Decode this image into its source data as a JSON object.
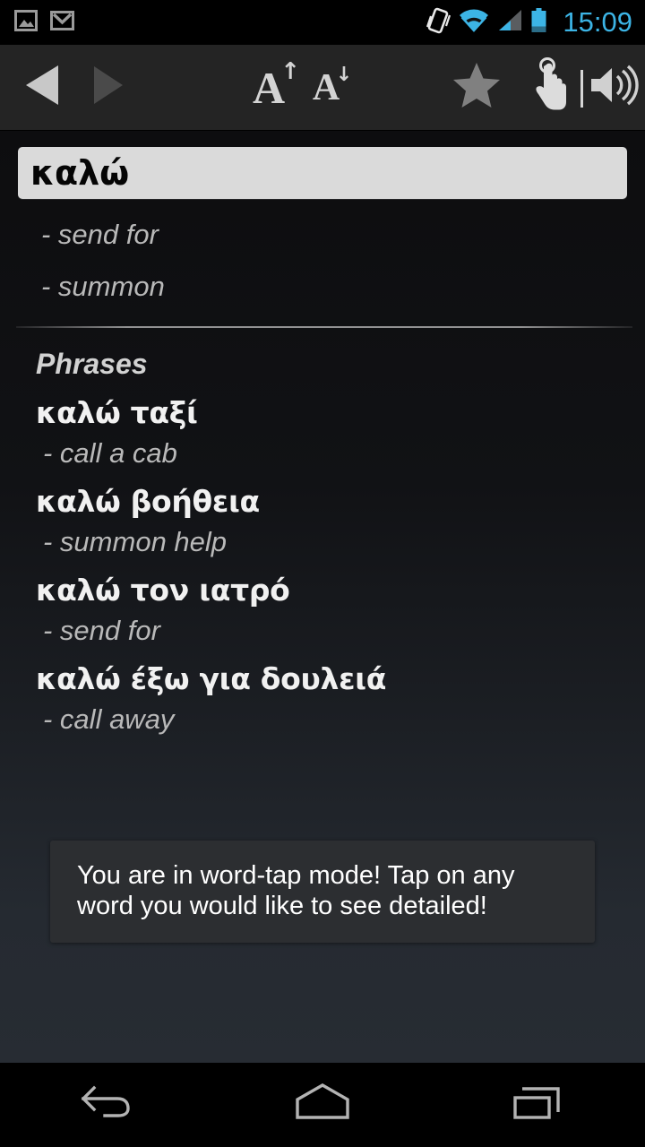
{
  "status_bar": {
    "notifications": [
      {
        "name": "gallery-icon",
        "label": "Gallery"
      },
      {
        "name": "gmail-icon",
        "label": "Gmail"
      }
    ],
    "indicators": [
      {
        "name": "vibrate-icon",
        "label": "Vibrate"
      },
      {
        "name": "wifi-icon",
        "label": "Wi-Fi"
      },
      {
        "name": "cellular-signal-icon",
        "label": "Signal"
      },
      {
        "name": "battery-icon",
        "label": "Battery"
      }
    ],
    "time": "15:09",
    "accent_color": "#3cb4e5"
  },
  "toolbar": {
    "nav_back_label": "Back",
    "nav_forward_label": "Forward",
    "font_increase_letter": "A",
    "font_increase_arrow": "↑",
    "font_decrease_letter": "A",
    "font_decrease_arrow": "↓",
    "favorite_label": "Favorite",
    "word_tap_label": "Word-tap mode",
    "sound_label": "Pronounce",
    "back_enabled": true,
    "forward_enabled": false,
    "enabled_color": "#c8c8c8",
    "disabled_color": "#4a4a4a",
    "background": "#242424"
  },
  "entry": {
    "headword": "καλώ",
    "definitions": [
      "- send for",
      "- summon"
    ]
  },
  "phrases_section": {
    "title": "Phrases",
    "items": [
      {
        "term": "καλώ ταξί",
        "definition": "- call a cab"
      },
      {
        "term": "καλώ βοήθεια",
        "definition": "- summon help"
      },
      {
        "term": "καλώ τον ιατρό",
        "definition": "- send for"
      },
      {
        "term": "καλώ έξω για δουλειά",
        "definition": "- call away"
      }
    ]
  },
  "toast": {
    "message": "You are in word-tap mode! Tap on any word you would like to see detailed!",
    "background": "#2c2e31"
  },
  "navbar": {
    "back_label": "Back",
    "home_label": "Home",
    "recents_label": "Recent apps"
  }
}
